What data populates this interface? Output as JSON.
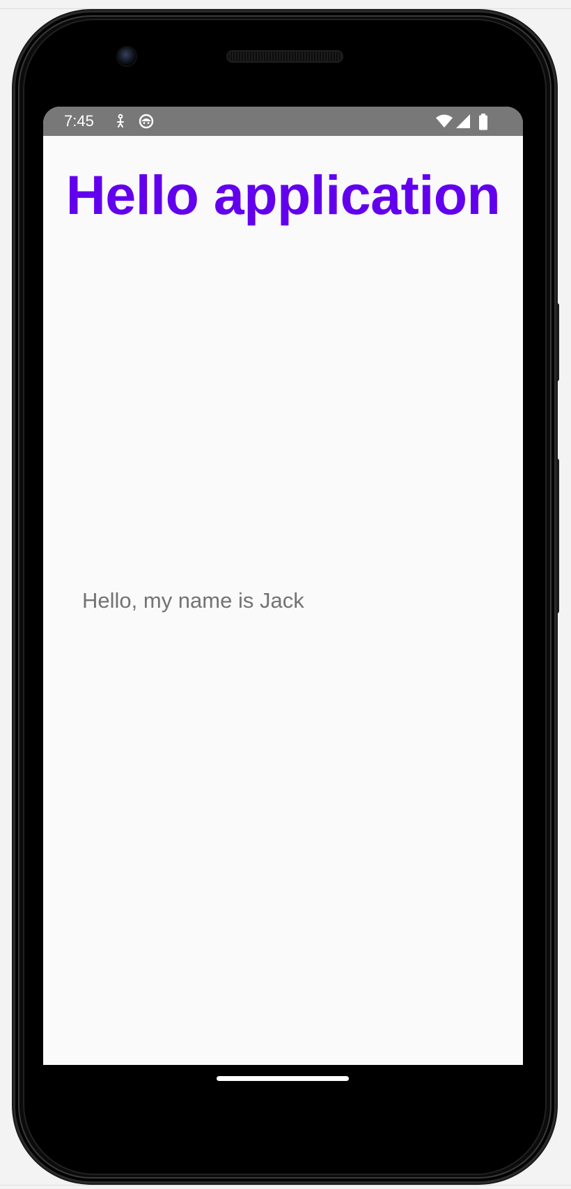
{
  "status_bar": {
    "time": "7:45",
    "icons": [
      "accessibility-icon",
      "android-icon",
      "wifi-icon",
      "signal-icon",
      "battery-icon"
    ],
    "background_color": "#787878"
  },
  "main": {
    "title": "Hello application",
    "message": "Hello, my name is Jack",
    "title_color": "#6200ee",
    "message_color": "#737373",
    "background_color": "#fafafa"
  }
}
